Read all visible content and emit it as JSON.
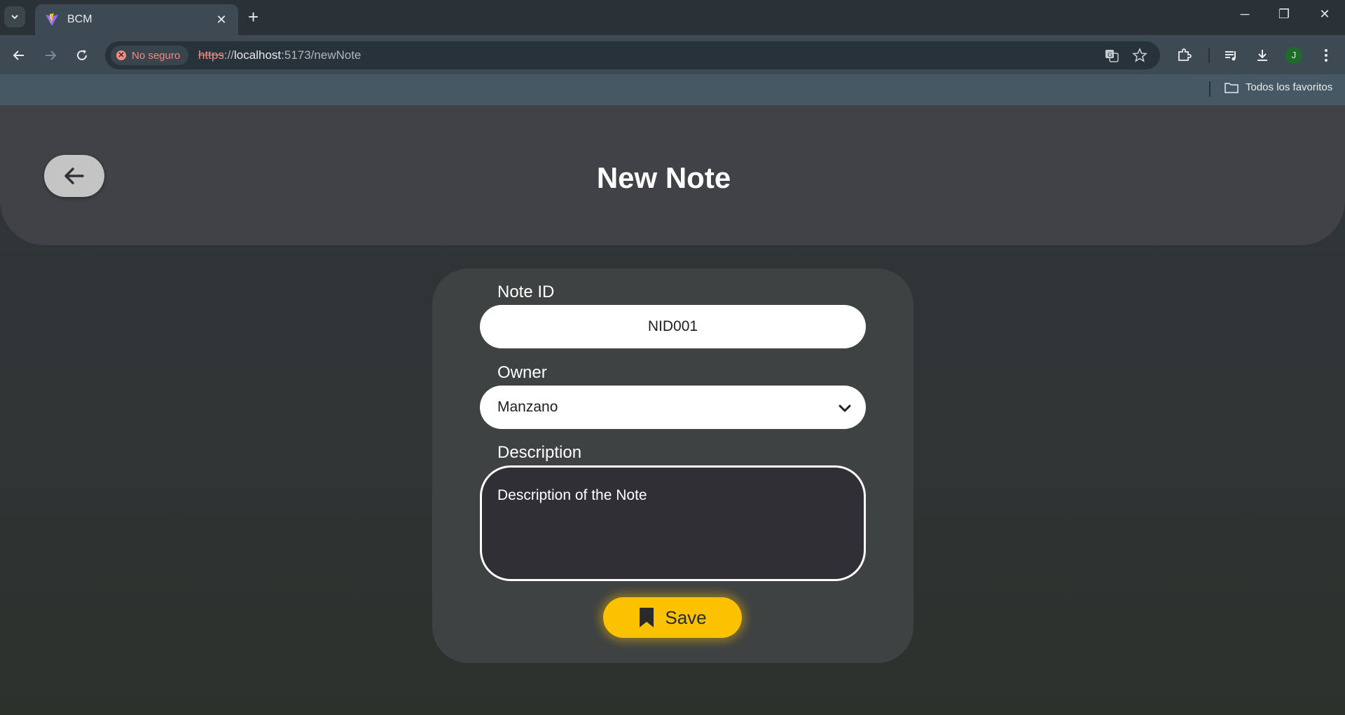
{
  "browser": {
    "tab_title": "BCM",
    "security_label": "No seguro",
    "url_scheme": "https",
    "url_sep": "://",
    "url_host": "localhost",
    "url_rest": ":5173/newNote",
    "bookmark_folder": "Todos los favoritos",
    "profile_initial": "J"
  },
  "header": {
    "title": "New Note"
  },
  "form": {
    "note_id_label": "Note ID",
    "note_id_value": "NID001",
    "owner_label": "Owner",
    "owner_value": "Manzano",
    "description_label": "Description",
    "description_value": "Description of the Note",
    "save_label": "Save"
  },
  "colors": {
    "accent": "#fcc100",
    "header_bg": "#414247",
    "card_bg": "#3f4242"
  }
}
